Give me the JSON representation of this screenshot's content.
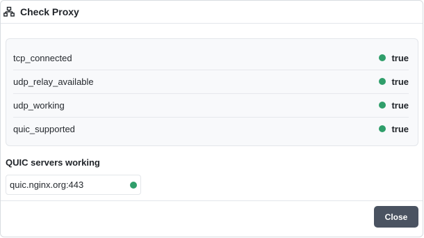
{
  "dialog": {
    "title": "Check Proxy",
    "icon": "network-icon"
  },
  "status": {
    "rows": [
      {
        "key": "tcp_connected",
        "value": "true"
      },
      {
        "key": "udp_relay_available",
        "value": "true"
      },
      {
        "key": "udp_working",
        "value": "true"
      },
      {
        "key": "quic_supported",
        "value": "true"
      }
    ],
    "ok_color": "#2f9e6a"
  },
  "quic": {
    "section_title": "QUIC servers working",
    "servers": [
      {
        "name": "quic.nginx.org:443"
      }
    ]
  },
  "footer": {
    "close_label": "Close",
    "button_color": "#4a5361"
  }
}
